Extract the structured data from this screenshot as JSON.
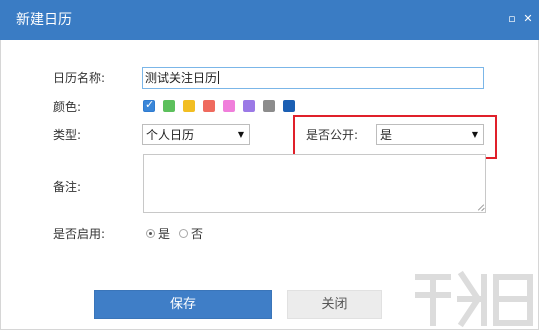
{
  "window": {
    "title": "新建日历",
    "restore_icon": "▫",
    "close_icon": "✕"
  },
  "form": {
    "name_label": "日历名称:",
    "name_value": "测试关注日历",
    "color_label": "颜色:",
    "colors": [
      "#3a86d8",
      "#5cc05c",
      "#f2be22",
      "#ef6a5e",
      "#f07edb",
      "#9b79e6",
      "#8c8c8c",
      "#1b5fb3"
    ],
    "selected_color_index": 0,
    "type_label": "类型:",
    "type_value": "个人日历",
    "public_label": "是否公开:",
    "public_value": "是",
    "remark_label": "备注:",
    "enabled_label": "是否启用:",
    "enabled_yes": "是",
    "enabled_no": "否",
    "enabled_selected": "是"
  },
  "buttons": {
    "save": "保存",
    "close": "关闭"
  },
  "colors": {
    "titlebar": "#3a7cc4",
    "primary": "#3f7ec7",
    "highlight": "#e0202a"
  }
}
